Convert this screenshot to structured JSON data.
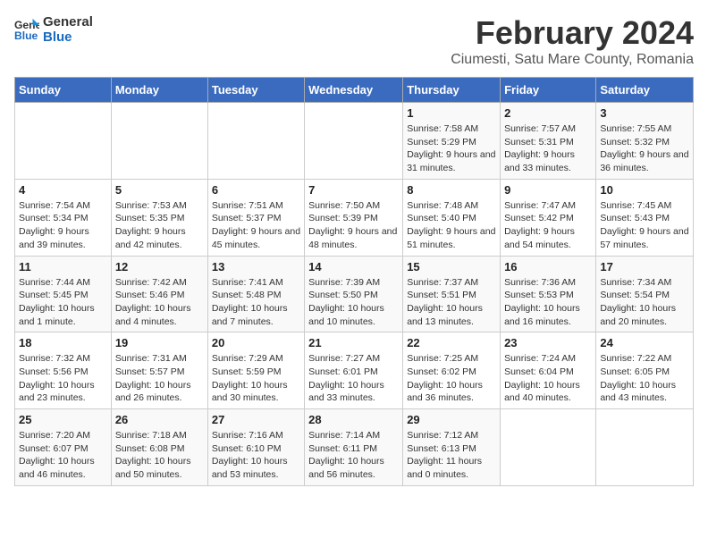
{
  "header": {
    "logo_line1": "General",
    "logo_line2": "Blue",
    "title": "February 2024",
    "subtitle": "Ciumesti, Satu Mare County, Romania"
  },
  "weekdays": [
    "Sunday",
    "Monday",
    "Tuesday",
    "Wednesday",
    "Thursday",
    "Friday",
    "Saturday"
  ],
  "weeks": [
    [
      {
        "day": "",
        "sunrise": "",
        "sunset": "",
        "daylight": ""
      },
      {
        "day": "",
        "sunrise": "",
        "sunset": "",
        "daylight": ""
      },
      {
        "day": "",
        "sunrise": "",
        "sunset": "",
        "daylight": ""
      },
      {
        "day": "",
        "sunrise": "",
        "sunset": "",
        "daylight": ""
      },
      {
        "day": "1",
        "sunrise": "Sunrise: 7:58 AM",
        "sunset": "Sunset: 5:29 PM",
        "daylight": "Daylight: 9 hours and 31 minutes."
      },
      {
        "day": "2",
        "sunrise": "Sunrise: 7:57 AM",
        "sunset": "Sunset: 5:31 PM",
        "daylight": "Daylight: 9 hours and 33 minutes."
      },
      {
        "day": "3",
        "sunrise": "Sunrise: 7:55 AM",
        "sunset": "Sunset: 5:32 PM",
        "daylight": "Daylight: 9 hours and 36 minutes."
      }
    ],
    [
      {
        "day": "4",
        "sunrise": "Sunrise: 7:54 AM",
        "sunset": "Sunset: 5:34 PM",
        "daylight": "Daylight: 9 hours and 39 minutes."
      },
      {
        "day": "5",
        "sunrise": "Sunrise: 7:53 AM",
        "sunset": "Sunset: 5:35 PM",
        "daylight": "Daylight: 9 hours and 42 minutes."
      },
      {
        "day": "6",
        "sunrise": "Sunrise: 7:51 AM",
        "sunset": "Sunset: 5:37 PM",
        "daylight": "Daylight: 9 hours and 45 minutes."
      },
      {
        "day": "7",
        "sunrise": "Sunrise: 7:50 AM",
        "sunset": "Sunset: 5:39 PM",
        "daylight": "Daylight: 9 hours and 48 minutes."
      },
      {
        "day": "8",
        "sunrise": "Sunrise: 7:48 AM",
        "sunset": "Sunset: 5:40 PM",
        "daylight": "Daylight: 9 hours and 51 minutes."
      },
      {
        "day": "9",
        "sunrise": "Sunrise: 7:47 AM",
        "sunset": "Sunset: 5:42 PM",
        "daylight": "Daylight: 9 hours and 54 minutes."
      },
      {
        "day": "10",
        "sunrise": "Sunrise: 7:45 AM",
        "sunset": "Sunset: 5:43 PM",
        "daylight": "Daylight: 9 hours and 57 minutes."
      }
    ],
    [
      {
        "day": "11",
        "sunrise": "Sunrise: 7:44 AM",
        "sunset": "Sunset: 5:45 PM",
        "daylight": "Daylight: 10 hours and 1 minute."
      },
      {
        "day": "12",
        "sunrise": "Sunrise: 7:42 AM",
        "sunset": "Sunset: 5:46 PM",
        "daylight": "Daylight: 10 hours and 4 minutes."
      },
      {
        "day": "13",
        "sunrise": "Sunrise: 7:41 AM",
        "sunset": "Sunset: 5:48 PM",
        "daylight": "Daylight: 10 hours and 7 minutes."
      },
      {
        "day": "14",
        "sunrise": "Sunrise: 7:39 AM",
        "sunset": "Sunset: 5:50 PM",
        "daylight": "Daylight: 10 hours and 10 minutes."
      },
      {
        "day": "15",
        "sunrise": "Sunrise: 7:37 AM",
        "sunset": "Sunset: 5:51 PM",
        "daylight": "Daylight: 10 hours and 13 minutes."
      },
      {
        "day": "16",
        "sunrise": "Sunrise: 7:36 AM",
        "sunset": "Sunset: 5:53 PM",
        "daylight": "Daylight: 10 hours and 16 minutes."
      },
      {
        "day": "17",
        "sunrise": "Sunrise: 7:34 AM",
        "sunset": "Sunset: 5:54 PM",
        "daylight": "Daylight: 10 hours and 20 minutes."
      }
    ],
    [
      {
        "day": "18",
        "sunrise": "Sunrise: 7:32 AM",
        "sunset": "Sunset: 5:56 PM",
        "daylight": "Daylight: 10 hours and 23 minutes."
      },
      {
        "day": "19",
        "sunrise": "Sunrise: 7:31 AM",
        "sunset": "Sunset: 5:57 PM",
        "daylight": "Daylight: 10 hours and 26 minutes."
      },
      {
        "day": "20",
        "sunrise": "Sunrise: 7:29 AM",
        "sunset": "Sunset: 5:59 PM",
        "daylight": "Daylight: 10 hours and 30 minutes."
      },
      {
        "day": "21",
        "sunrise": "Sunrise: 7:27 AM",
        "sunset": "Sunset: 6:01 PM",
        "daylight": "Daylight: 10 hours and 33 minutes."
      },
      {
        "day": "22",
        "sunrise": "Sunrise: 7:25 AM",
        "sunset": "Sunset: 6:02 PM",
        "daylight": "Daylight: 10 hours and 36 minutes."
      },
      {
        "day": "23",
        "sunrise": "Sunrise: 7:24 AM",
        "sunset": "Sunset: 6:04 PM",
        "daylight": "Daylight: 10 hours and 40 minutes."
      },
      {
        "day": "24",
        "sunrise": "Sunrise: 7:22 AM",
        "sunset": "Sunset: 6:05 PM",
        "daylight": "Daylight: 10 hours and 43 minutes."
      }
    ],
    [
      {
        "day": "25",
        "sunrise": "Sunrise: 7:20 AM",
        "sunset": "Sunset: 6:07 PM",
        "daylight": "Daylight: 10 hours and 46 minutes."
      },
      {
        "day": "26",
        "sunrise": "Sunrise: 7:18 AM",
        "sunset": "Sunset: 6:08 PM",
        "daylight": "Daylight: 10 hours and 50 minutes."
      },
      {
        "day": "27",
        "sunrise": "Sunrise: 7:16 AM",
        "sunset": "Sunset: 6:10 PM",
        "daylight": "Daylight: 10 hours and 53 minutes."
      },
      {
        "day": "28",
        "sunrise": "Sunrise: 7:14 AM",
        "sunset": "Sunset: 6:11 PM",
        "daylight": "Daylight: 10 hours and 56 minutes."
      },
      {
        "day": "29",
        "sunrise": "Sunrise: 7:12 AM",
        "sunset": "Sunset: 6:13 PM",
        "daylight": "Daylight: 11 hours and 0 minutes."
      },
      {
        "day": "",
        "sunrise": "",
        "sunset": "",
        "daylight": ""
      },
      {
        "day": "",
        "sunrise": "",
        "sunset": "",
        "daylight": ""
      }
    ]
  ]
}
